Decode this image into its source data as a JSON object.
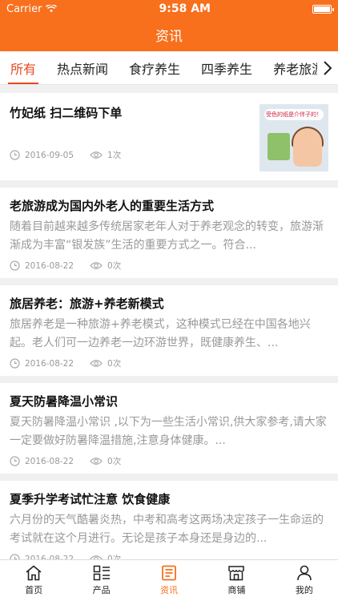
{
  "status": {
    "carrier": "Carrier",
    "time": "9:58 AM"
  },
  "nav": {
    "title": "资讯"
  },
  "tabs": [
    "所有",
    "热点新闻",
    "食疗养生",
    "四季养生",
    "养老旅游"
  ],
  "thumb_text": "受色的纸是介伴子的！",
  "articles": [
    {
      "title": "竹妃纸 扫二维码下单",
      "summary": "",
      "date": "2016-09-05",
      "views": "1次"
    },
    {
      "title": "老旅游成为国内外老人的重要生活方式",
      "summary": "随着目前越来越多传统居家老年人对于养老观念的转变，旅游渐渐成为丰富“银发族”生活的重要方式之一。符合...",
      "date": "2016-08-22",
      "views": "0次"
    },
    {
      "title": "旅居养老：旅游+养老新模式",
      "summary": "旅居养老是一种旅游+养老模式，这种模式已经在中国各地兴起。老人们可一边养老一边环游世界，既健康养生、...",
      "date": "2016-08-22",
      "views": "0次"
    },
    {
      "title": "夏天防暑降温小常识",
      "summary": "夏天防暑降温小常识 ,以下为一些生活小常识,供大家参考,请大家一定要做好防暑降温措施,注意身体健康。...",
      "date": "2016-08-22",
      "views": "0次"
    },
    {
      "title": "夏季升学考试忙注意 饮食健康",
      "summary": "六月份的天气酷暑炎热，中考和高考这两场决定孩子一生命运的考试就在这个月进行。无论是孩子本身还是身边的...",
      "date": "2016-08-22",
      "views": "0次"
    }
  ],
  "tabbar": [
    "首页",
    "产品",
    "资讯",
    "商铺",
    "我的"
  ],
  "colors": {
    "brand": "#f86f1c",
    "active_tab": "#e8491e"
  }
}
